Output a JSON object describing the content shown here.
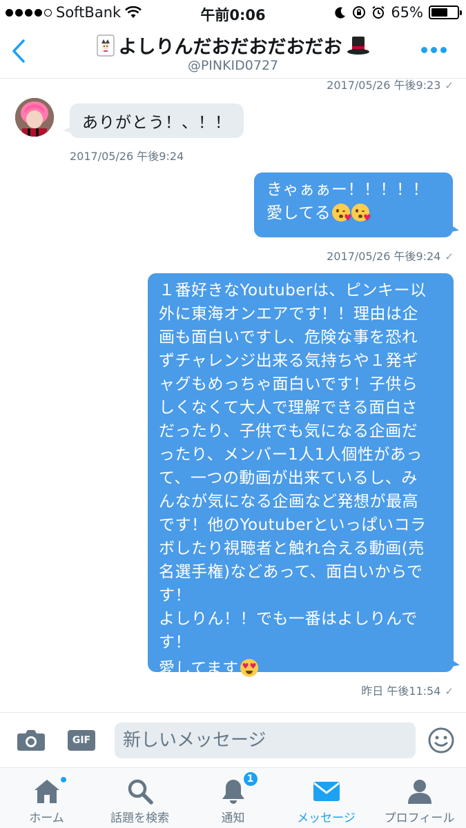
{
  "status_bar": {
    "carrier": "SoftBank",
    "time": "午前0:06",
    "battery": "65%",
    "battery_level": 0.65
  },
  "header": {
    "back_icon": "chevron-left-icon",
    "title": "よしりんだおだおだおだお",
    "handle": "@PINKID0727",
    "more_icon": "more-dots-icon",
    "accent_color": "#1da1f2"
  },
  "conversation": {
    "top_timestamp": "2017/05/26 午後9:23",
    "received_message": "ありがとう！、！！",
    "received_timestamp": "2017/05/26 午後9:24",
    "sent_messages": [
      {
        "lines": [
          "きゃぁぁー！！！！！",
          "愛してる"
        ],
        "timestamp": "2017/05/26 午後9:24"
      },
      {
        "lines": [
          "１番好きなYoutuberは、ピンキー以",
          "外に東海オンエアです！！理由は企",
          "画も面白いですし、危険な事を恐れ",
          "ずチャレンジ出来る気持ちや１発ギ",
          "ャグもめっちゃ面白いです！子供ら",
          "しくなくて大人で理解できる面白さ",
          "だったり、子供でも気になる企画だ",
          "ったり、メンバー1人1人個性があっ",
          "て、一つの動画が出来ているし、み",
          "んなが気になる企画など発想が最高",
          "です！他のYoutuberといっぱいコラ",
          "ボしたり視聴者と触れ合える動画(売",
          "名選手権)などあって、面白いからで",
          "す！",
          "よしりん！！でも一番はよしりんで",
          "す！",
          "愛してます"
        ],
        "timestamp": "昨日 午後11:54"
      }
    ],
    "sent_bubble_color": "#4a9be8",
    "received_bubble_color": "#e6ecf0"
  },
  "composer": {
    "camera_icon": "camera-icon",
    "gif_label": "GIF",
    "placeholder": "新しいメッセージ",
    "emoji_icon": "smiley-icon"
  },
  "tabs": [
    {
      "label": "ホーム",
      "icon": "home-icon"
    },
    {
      "label": "話題を検索",
      "icon": "search-icon"
    },
    {
      "label": "通知",
      "icon": "bell-icon",
      "badge": "1"
    },
    {
      "label": "メッセージ",
      "icon": "envelope-icon",
      "active": true
    },
    {
      "label": "プロフィール",
      "icon": "person-icon"
    }
  ]
}
